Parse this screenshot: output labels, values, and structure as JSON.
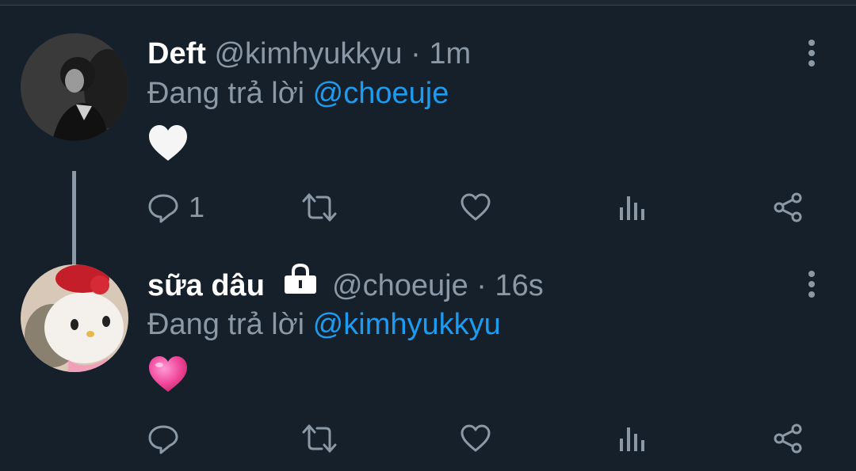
{
  "tweets": [
    {
      "name": "Deft",
      "handle": "@kimhyukkyu",
      "separator": "·",
      "time": "1m",
      "reply_prefix": "Đang trả lời",
      "reply_to": "@choeuje",
      "content_emoji": "white-heart",
      "reply_count": "1",
      "protected": false
    },
    {
      "name": "sữa dâu",
      "handle": "@choeuje",
      "separator": "·",
      "time": "16s",
      "reply_prefix": "Đang trả lời",
      "reply_to": "@kimhyukkyu",
      "content_emoji": "pink-heart",
      "reply_count": "",
      "protected": true
    }
  ],
  "colors": {
    "background": "#15202b",
    "secondary_text": "#8b98a5",
    "accent": "#1d9bf0"
  },
  "icons": [
    "reply-icon",
    "retweet-icon",
    "like-icon",
    "analytics-icon",
    "share-icon",
    "more-icon",
    "lock-icon"
  ]
}
